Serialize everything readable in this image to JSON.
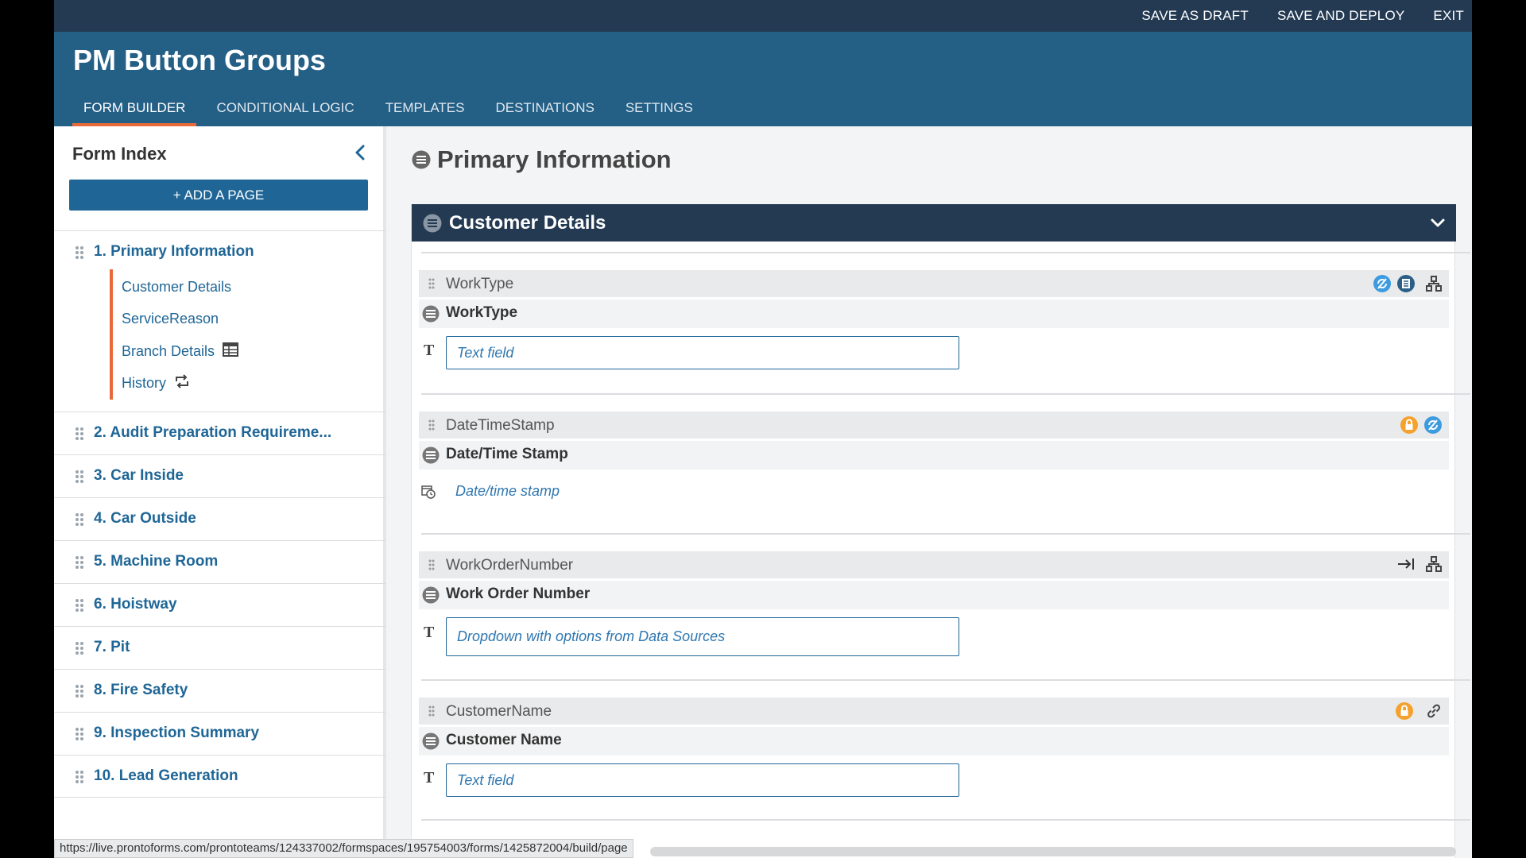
{
  "topbar": {
    "save_draft": "SAVE AS DRAFT",
    "save_deploy": "SAVE AND DEPLOY",
    "exit": "EXIT"
  },
  "header": {
    "title": "PM Button Groups",
    "tabs": [
      {
        "label": "FORM BUILDER"
      },
      {
        "label": "CONDITIONAL LOGIC"
      },
      {
        "label": "TEMPLATES"
      },
      {
        "label": "DESTINATIONS"
      },
      {
        "label": "SETTINGS"
      }
    ]
  },
  "sidebar": {
    "title": "Form Index",
    "add_page": "+ ADD A PAGE",
    "pages": [
      {
        "label": "1. Primary Information"
      },
      {
        "label": "2. Audit Preparation Requireme..."
      },
      {
        "label": "3. Car Inside"
      },
      {
        "label": "4. Car Outside"
      },
      {
        "label": "5. Machine Room"
      },
      {
        "label": "6. Hoistway"
      },
      {
        "label": "7. Pit"
      },
      {
        "label": "8. Fire Safety"
      },
      {
        "label": "9. Inspection Summary"
      },
      {
        "label": "10. Lead Generation"
      }
    ],
    "subsections": [
      {
        "label": "Customer Details",
        "icon": ""
      },
      {
        "label": "ServiceReason",
        "icon": ""
      },
      {
        "label": "Branch Details",
        "icon": "table-icon"
      },
      {
        "label": "History",
        "icon": "repeat-icon"
      }
    ]
  },
  "main": {
    "page_title": "Primary Information",
    "section_title": "Customer Details",
    "fields": [
      {
        "name": "WorkType",
        "label": "WorkType",
        "placeholder": "Text field",
        "icons": [
          "sync-icon",
          "list-icon",
          "hierarchy-icon"
        ]
      },
      {
        "name": "DateTimeStamp",
        "label": "Date/Time Stamp",
        "placeholder": "Date/time stamp",
        "icons": [
          "lock-icon",
          "sync-icon"
        ]
      },
      {
        "name": "WorkOrderNumber",
        "label": "Work Order Number",
        "placeholder": "Dropdown with options from Data Sources",
        "icons": [
          "arrow-to-end-icon",
          "hierarchy-icon"
        ]
      },
      {
        "name": "CustomerName",
        "label": "Customer Name",
        "placeholder": "Text field",
        "icons": [
          "lock-icon",
          "link-icon"
        ]
      }
    ],
    "text_type_glyph": "T"
  },
  "status_url": "https://live.prontoforms.com/prontoteams/124337002/formspaces/195754003/forms/1425872004/build/page",
  "colors": {
    "topbar": "#233a52",
    "header": "#245f86",
    "accent": "#e86a3a",
    "link": "#1f6696",
    "lock": "#f4a12d",
    "sync": "#3d9be0"
  }
}
